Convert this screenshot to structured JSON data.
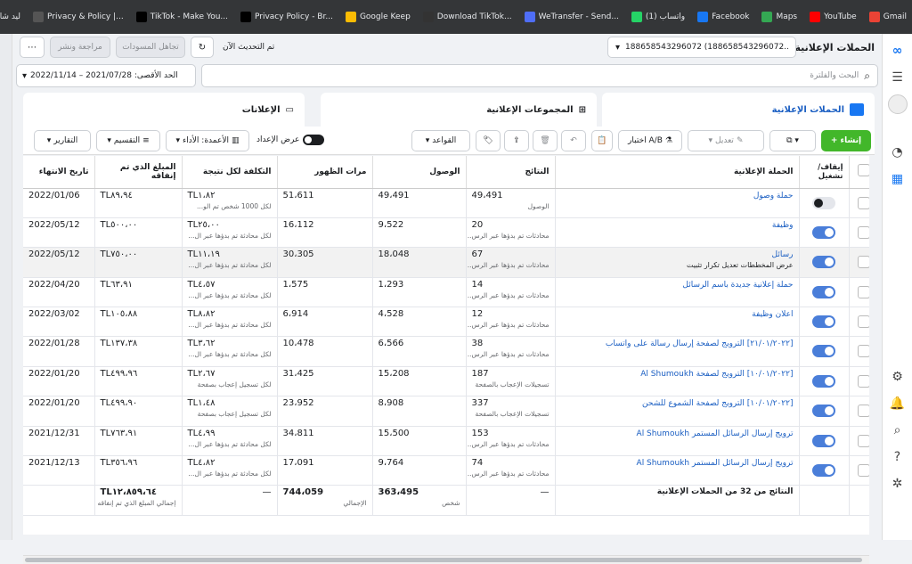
{
  "bookmarks": [
    {
      "label": "Gmail",
      "color": "#ea4335"
    },
    {
      "label": "YouTube",
      "color": "#ff0000"
    },
    {
      "label": "Maps",
      "color": "#34a853"
    },
    {
      "label": "Facebook",
      "color": "#1877f2"
    },
    {
      "label": "(1) واتساب",
      "color": "#25d366"
    },
    {
      "label": "WeTransfer - Send...",
      "color": "#4f6ef7"
    },
    {
      "label": "Download TikTok...",
      "color": "#333"
    },
    {
      "label": "Google Keep",
      "color": "#fbbc04"
    },
    {
      "label": "Privacy Policy - Br...",
      "color": "#000"
    },
    {
      "label": "TikTok - Make You...",
      "color": "#000"
    },
    {
      "label": "Privacy & Policy |...",
      "color": "#555"
    },
    {
      "label": "ليد شات",
      "color": "#34a853"
    }
  ],
  "header": {
    "title": "الحملات الإعلانية",
    "account": "188658543296072 (188658543296072...",
    "updated": "تم التحديث الآن",
    "discard": "تجاهل المسودات",
    "review": "مراجعة ونشر",
    "search_placeholder": "البحث والفلترة",
    "date_range": "الحد الأقصى: 2021/07/28 – 2022/11/14"
  },
  "tabs": {
    "campaigns": "الحملات الإعلانية",
    "adsets": "المجموعات الإعلانية",
    "ads": "الإعلانات"
  },
  "toolbar": {
    "create": "+ إنشاء",
    "edit": "تعديل",
    "ab": "اختبار A/B",
    "rules": "القواعد",
    "view_setup": "عرض الإعداد",
    "columns": "الأعمدة: الأداء",
    "breakdown": "التقسيم",
    "reports": "التقارير"
  },
  "columns": {
    "onoff": "إيقاف/تشغيل",
    "campaign": "الحملة الإعلانية",
    "results": "النتائج",
    "reach": "الوصول",
    "impressions": "مرات الظهور",
    "cpr": "التكلفة لكل نتيجة",
    "spent": "المبلغ الذي تم إنفاقه",
    "end": "تاريخ الانتهاء"
  },
  "rows": [
    {
      "on": false,
      "name": "حملة وصول",
      "results": "49،491",
      "rsub": "الوصول",
      "reach": "49،491",
      "imp": "51،611",
      "cpr": "TL١،٨٢",
      "csub": "لكل 1000 شخص تم الو...",
      "spent": "TL٨٩،٩٤",
      "end": "2022/01/06"
    },
    {
      "on": true,
      "name": "وظيفة",
      "results": "20",
      "rsub": "محادثات تم بدؤها عبر الرس...",
      "reach": "9،522",
      "imp": "16،112",
      "cpr": "TL٢٥،٠٠",
      "csub": "لكل محادثة تم بدؤها عبر ال...",
      "spent": "TL٥٠٠،٠٠",
      "end": "2022/05/12"
    },
    {
      "on": true,
      "name": "رسائل",
      "results": "67",
      "rsub": "محادثات تم بدؤها عبر الرس...",
      "reach": "18،048",
      "imp": "30،305",
      "cpr": "TL١١،١٩",
      "csub": "لكل محادثة تم بدؤها عبر ال...",
      "spent": "TL٧٥٠،٠٠",
      "end": "2022/05/12",
      "hover": true
    },
    {
      "on": true,
      "name": "حملة إعلانية جديدة باسم الرسائل",
      "results": "14",
      "rsub": "محادثات تم بدؤها عبر الرس...",
      "reach": "1،293",
      "imp": "1،575",
      "cpr": "TL٤،٥٧",
      "csub": "لكل محادثة تم بدؤها عبر ال...",
      "spent": "TL٦٣،٩١",
      "end": "2022/04/20"
    },
    {
      "on": true,
      "name": "اعلان وظيفة",
      "results": "12",
      "rsub": "محادثات تم بدؤها عبر الرس...",
      "reach": "4،528",
      "imp": "6،914",
      "cpr": "TL٨،٨٢",
      "csub": "لكل محادثة تم بدؤها عبر ال...",
      "spent": "TL١٠٥،٨٨",
      "end": "2022/03/02"
    },
    {
      "on": true,
      "name": "[٢١/٠١/٢٠٢٢] الترويج لصفحة إرسال رسالة على واتساب",
      "results": "38",
      "rsub": "محادثات تم بدؤها عبر الرس...",
      "reach": "6،566",
      "imp": "10،478",
      "cpr": "TL٣،٦٢",
      "csub": "لكل محادثة تم بدؤها عبر ال...",
      "spent": "TL١٣٧،٣٨",
      "end": "2022/01/28"
    },
    {
      "on": true,
      "name": "[١٠/٠١/٢٠٢٢] الترويج لصفحة Al Shumoukh",
      "results": "187",
      "rsub": "تسجيلات الإعجاب بالصفحة",
      "reach": "15،208",
      "imp": "31،425",
      "cpr": "TL٢،٦٧",
      "csub": "لكل تسجيل إعجاب بصفحة",
      "spent": "TL٤٩٩،٩٦",
      "end": "2022/01/20"
    },
    {
      "on": true,
      "name": "[١٠/٠١/٢٠٢٢] الترويج لصفحة الشموع للشحن",
      "results": "337",
      "rsub": "تسجيلات الإعجاب بالصفحة",
      "reach": "8،908",
      "imp": "23،952",
      "cpr": "TL١،٤٨",
      "csub": "لكل تسجيل إعجاب بصفحة",
      "spent": "TL٤٩٩،٩٠",
      "end": "2022/01/20"
    },
    {
      "on": true,
      "name": "ترويج إرسال الرسائل المستمر Al Shumoukh",
      "results": "153",
      "rsub": "محادثات تم بدؤها عبر الرس...",
      "reach": "15،500",
      "imp": "34،811",
      "cpr": "TL٤،٩٩",
      "csub": "لكل محادثة تم بدؤها عبر ال...",
      "spent": "TL٧٦٣،٩١",
      "end": "2021/12/31"
    },
    {
      "on": true,
      "name": "ترويج إرسال الرسائل المستمر Al Shumoukh",
      "results": "74",
      "rsub": "محادثات تم بدؤها عبر الرس...",
      "reach": "9،764",
      "imp": "17،091",
      "cpr": "TL٤،٨٢",
      "csub": "لكل محادثة تم بدؤها عبر ال...",
      "spent": "TL٣٥٦،٩٦",
      "end": "2021/12/13"
    }
  ],
  "hover_actions": "عرض المخططات  تعديل  تكرار  تثبيت",
  "totals": {
    "label": "النتائج من 32 من الحملات الإعلانية",
    "reach": "363،495",
    "rsub": "شخص",
    "imp": "744،059",
    "isub": "الإجمالي",
    "spent": "TL١٢،٨٥٩،٦٤",
    "ssub": "إجمالي المبلغ الذي تم إنفاقه",
    "dash": "—"
  }
}
